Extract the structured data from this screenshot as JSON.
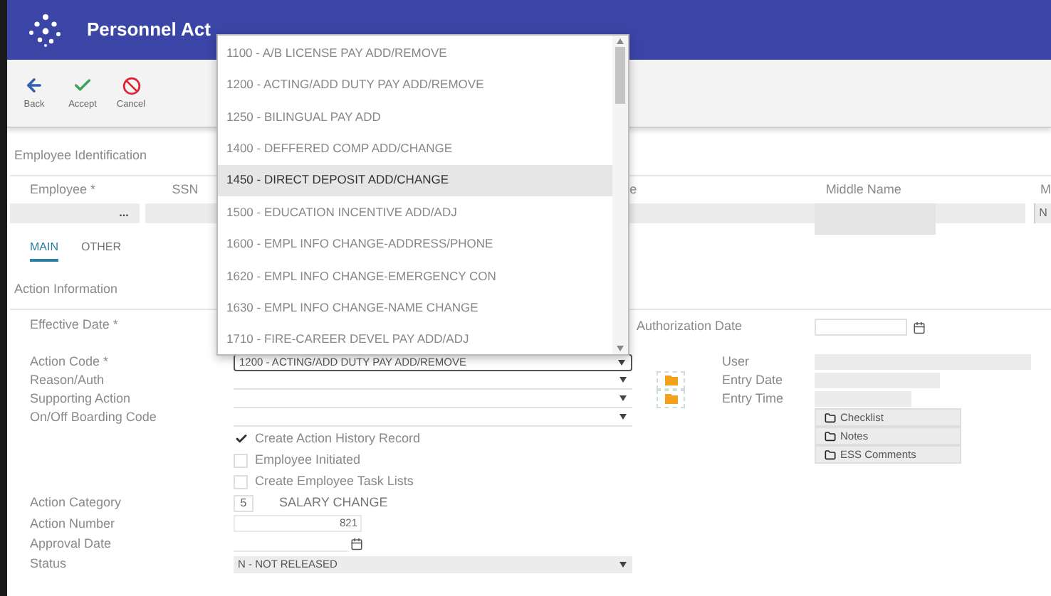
{
  "header": {
    "title": "Personnel Act"
  },
  "toolbar": [
    {
      "label": "Back",
      "kind": "back"
    },
    {
      "label": "Accept",
      "kind": "accept"
    },
    {
      "label": "Cancel",
      "kind": "cancel"
    }
  ],
  "employee_identification": {
    "title": "Employee Identification",
    "columns": [
      "Employee *",
      "SSN",
      "e",
      "Middle Name",
      "M"
    ],
    "lookup_button": "...",
    "column_5_value": "N"
  },
  "tabs": [
    {
      "label": "MAIN",
      "selected": true
    },
    {
      "label": "OTHER",
      "selected": false
    }
  ],
  "action_information": {
    "title": "Action Information",
    "rows": [
      {
        "label": "Effective Date *",
        "kind": "blank"
      },
      {
        "label": "Action Code *",
        "kind": "select",
        "value": "1200 - ACTING/ADD DUTY PAY ADD/REMOVE",
        "focused": true
      },
      {
        "label": "Reason/Auth",
        "kind": "select",
        "value": "",
        "focused": false
      },
      {
        "label": "Supporting Action",
        "kind": "select",
        "value": "",
        "focused": false
      },
      {
        "label": "On/Off Boarding Code",
        "kind": "select",
        "value": "",
        "focused": false
      }
    ],
    "checkboxes": [
      {
        "label": "Create Action History Record",
        "checked": true
      },
      {
        "label": "Employee Initiated",
        "checked": false
      },
      {
        "label": "Create Employee Task Lists",
        "checked": false
      }
    ],
    "action_category": {
      "label": "Action Category",
      "code": "5",
      "name": "SALARY CHANGE"
    },
    "action_number": {
      "label": "Action Number",
      "value": "821"
    },
    "approval_date": {
      "label": "Approval Date"
    },
    "status": {
      "label": "Status",
      "value": "N - NOT RELEASED"
    },
    "authorization_date": {
      "label": "Authorization Date"
    },
    "audit": [
      {
        "label": "User",
        "folder": false
      },
      {
        "label": "Entry Date",
        "folder": true
      },
      {
        "label": "Entry Time",
        "folder": true
      }
    ],
    "buttons": [
      "Checklist",
      "Notes",
      "ESS Comments"
    ]
  },
  "dropdown": {
    "items": [
      {
        "label": "1100 - A/B LICENSE PAY ADD/REMOVE",
        "selected": false
      },
      {
        "label": "1200 - ACTING/ADD DUTY PAY ADD/REMOVE",
        "selected": false
      },
      {
        "label": "1250 - BILINGUAL PAY ADD",
        "selected": false
      },
      {
        "label": "1400 - DEFFERED COMP ADD/CHANGE",
        "selected": false
      },
      {
        "label": "1450 - DIRECT DEPOSIT ADD/CHANGE",
        "selected": true
      },
      {
        "label": "1500 - EDUCATION INCENTIVE ADD/ADJ",
        "selected": false
      },
      {
        "label": "1600 - EMPL INFO CHANGE-ADDRESS/PHONE",
        "selected": false
      },
      {
        "label": "1620 - EMPL INFO CHANGE-EMERGENCY CON",
        "selected": false
      },
      {
        "label": "1630 - EMPL INFO CHANGE-NAME CHANGE",
        "selected": false
      },
      {
        "label": "1710 - FIRE-CAREER DEVEL PAY ADD/ADJ",
        "selected": false
      }
    ]
  }
}
